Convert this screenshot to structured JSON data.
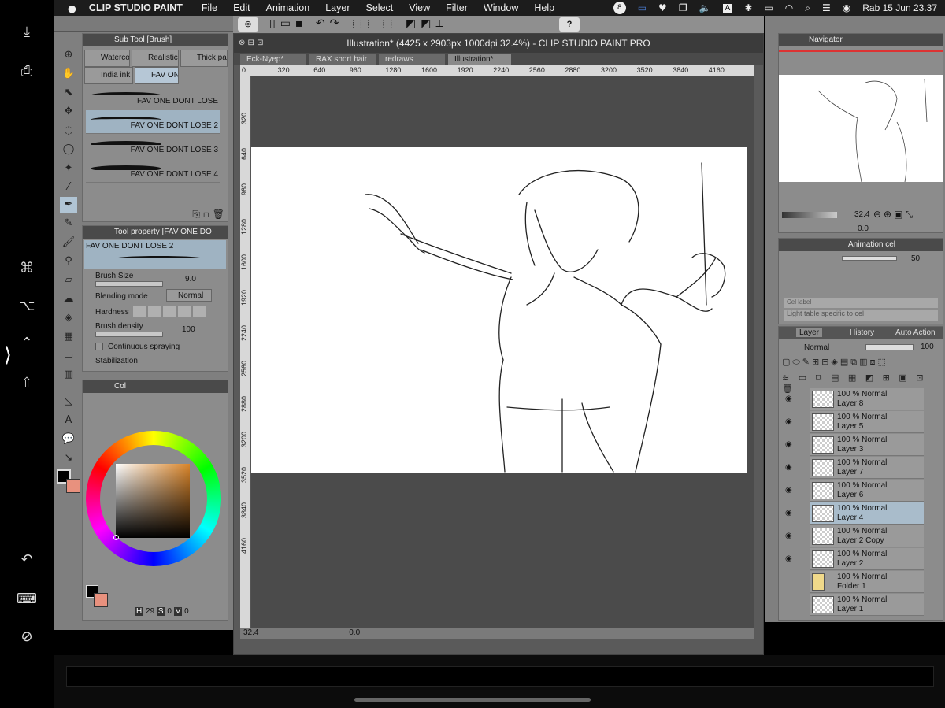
{
  "menubar": {
    "app_name": "CLIP STUDIO PAINT",
    "items": [
      "File",
      "Edit",
      "Animation",
      "Layer",
      "Select",
      "View",
      "Filter",
      "Window",
      "Help"
    ],
    "status": {
      "date_time": "Rab 15 Jun  23.37",
      "notification_count": "8"
    }
  },
  "ipad_strip": {
    "icons": [
      "download-icon",
      "screen-icon",
      "command-icon",
      "option-icon",
      "expand-icon",
      "caret-up-icon",
      "shift-icon",
      "undo-icon",
      "keyboard-icon",
      "no-display-icon"
    ]
  },
  "subtool": {
    "title": "Sub Tool [Brush]",
    "tabs": [
      "Waterco",
      "Realistic",
      "Thick pa",
      "India ink",
      "FAV ON"
    ],
    "brushes": [
      "FAV ONE DONT LOSE",
      "FAV ONE DONT LOSE 2",
      "FAV ONE DONT LOSE 3",
      "FAV ONE DONT LOSE 4"
    ]
  },
  "toolprop": {
    "title": "Tool property [FAV ONE DO",
    "brush_name": "FAV ONE DONT LOSE 2",
    "brush_size_label": "Brush Size",
    "brush_size_value": "9.0",
    "blending_label": "Blending mode",
    "blending_value": "Normal",
    "hardness_label": "Hardness",
    "density_label": "Brush density",
    "density_value": "100",
    "spray_label": "Continuous spraying",
    "stabilization_label": "Stabilization"
  },
  "color": {
    "tab": "Col",
    "readout": {
      "h_label": "H",
      "h": "29",
      "s_label": "S",
      "s": "0",
      "v_label": "V",
      "v": "0"
    },
    "main_color": "#000000",
    "sub_color": "#e8917e",
    "picker_hue": "#d9852a"
  },
  "document": {
    "title": "Illustration* (4425 x 2903px 1000dpi 32.4%)  - CLIP STUDIO PAINT PRO",
    "tabs": [
      "Eck-Nyep*",
      "RAX short hair",
      "redraws",
      "Illustration*"
    ],
    "ruler_h": [
      "0",
      "320",
      "640",
      "960",
      "1280",
      "1600",
      "1920",
      "2240",
      "2560",
      "2880",
      "3200",
      "3520",
      "3840",
      "4160"
    ],
    "ruler_v": [
      "320",
      "640",
      "960",
      "1280",
      "1600",
      "1920",
      "2240",
      "2560",
      "2880",
      "3200",
      "3520",
      "3840",
      "4160"
    ],
    "zoom": "32.4",
    "angle": "0.0"
  },
  "navigator": {
    "title": "Navigator",
    "zoom": "32.4",
    "angle": "0.0"
  },
  "animcel": {
    "title": "Animation cel",
    "value": "50",
    "field_label": "Light table specific to cel",
    "field_label_top": "Cel label"
  },
  "layers": {
    "tabs": [
      "Layer",
      "History",
      "Auto Action"
    ],
    "blend_mode": "Normal",
    "opacity": "100",
    "rows": [
      {
        "opacity_mode": "100 %  Normal",
        "name": "Layer 8"
      },
      {
        "opacity_mode": "100 %  Normal",
        "name": "Layer 5"
      },
      {
        "opacity_mode": "100 %  Normal",
        "name": "Layer 3"
      },
      {
        "opacity_mode": "100 %  Normal",
        "name": "Layer 7"
      },
      {
        "opacity_mode": "100 %  Normal",
        "name": "Layer 6"
      },
      {
        "opacity_mode": "100 %  Normal",
        "name": "Layer 4"
      },
      {
        "opacity_mode": "100 %  Normal",
        "name": "Layer 2 Copy"
      },
      {
        "opacity_mode": "100 %  Normal",
        "name": "Layer 2"
      },
      {
        "opacity_mode": "100 %  Normal",
        "name": "Folder 1"
      },
      {
        "opacity_mode": "100 %  Normal",
        "name": "Layer 1"
      }
    ],
    "selected_index": 5
  }
}
